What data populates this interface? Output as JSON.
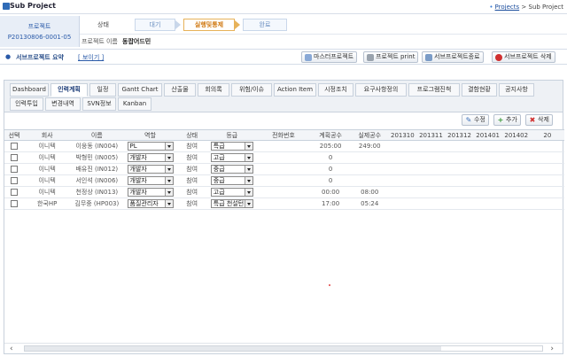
{
  "window": {
    "title": "Sub Project"
  },
  "breadcrumb": {
    "link": "Projects",
    "separator": ">",
    "current": "Sub Project"
  },
  "project": {
    "label": "프로젝트",
    "id": "P20130806-0001-05"
  },
  "status": {
    "label": "상태",
    "steps": [
      "대기",
      "실행및통제",
      "완료"
    ],
    "active_step": "실행및통제"
  },
  "project_name": {
    "label": "프로젝트 이름",
    "value": "동팝어드민"
  },
  "summary": {
    "title": "서브프로젝트 요약",
    "toggle": "[ 보이기 ]"
  },
  "actions": {
    "master": "마스터프로젝트",
    "print": "프로젝트 print",
    "close": "서브프로젝트종료",
    "delete": "서브프로젝트 삭제"
  },
  "tabs": {
    "row1": [
      "Dashboard",
      "인력계획",
      "일정",
      "Gantt Chart",
      "산출물",
      "회의록",
      "위험/이슈",
      "Action Item",
      "시정조치",
      "요구사항정의",
      "프로그램진척",
      "결함현황",
      "공지사항"
    ],
    "row2": [
      "인력투입",
      "변경내역",
      "SVN정보",
      "Kanban"
    ],
    "active": "인력계획"
  },
  "toolbar": {
    "edit": "수정",
    "add": "추가",
    "delete": "삭제"
  },
  "table": {
    "headers": [
      "선택",
      "회사",
      "이름",
      "역할",
      "상태",
      "등급",
      "전화번호",
      "계획공수",
      "실제공수",
      "201310",
      "201311",
      "201312",
      "201401",
      "201402",
      "20"
    ],
    "rows": [
      {
        "company": "이니텍",
        "name": "이웅동 (IN004)",
        "role": "PL",
        "status": "참여",
        "grade": "특급",
        "phone": "",
        "plan": "205:00",
        "actual": "249:00"
      },
      {
        "company": "이니텍",
        "name": "박형민 (IN005)",
        "role": "개발자",
        "status": "참여",
        "grade": "고급",
        "phone": "",
        "plan": "0",
        "actual": ""
      },
      {
        "company": "이니텍",
        "name": "배유진 (IN012)",
        "role": "개발자",
        "status": "참여",
        "grade": "중급",
        "phone": "",
        "plan": "0",
        "actual": ""
      },
      {
        "company": "이니텍",
        "name": "서인석 (IN006)",
        "role": "개발자",
        "status": "참여",
        "grade": "중급",
        "phone": "",
        "plan": "0",
        "actual": ""
      },
      {
        "company": "이니텍",
        "name": "천정상 (IN013)",
        "role": "개발자",
        "status": "참여",
        "grade": "고급",
        "phone": "",
        "plan": "00:00",
        "actual": "08:00"
      },
      {
        "company": "한국HP",
        "name": "김무중 (HP003)",
        "role": "품질관리자",
        "status": "참여",
        "grade": "특급 천설턴",
        "phone": "",
        "plan": "17:00",
        "actual": "05:24"
      }
    ]
  },
  "colors": {
    "accent": "#2a5aa8",
    "active_step": "#d07a15",
    "delete": "#d03030",
    "add": "#3a9a3a"
  }
}
